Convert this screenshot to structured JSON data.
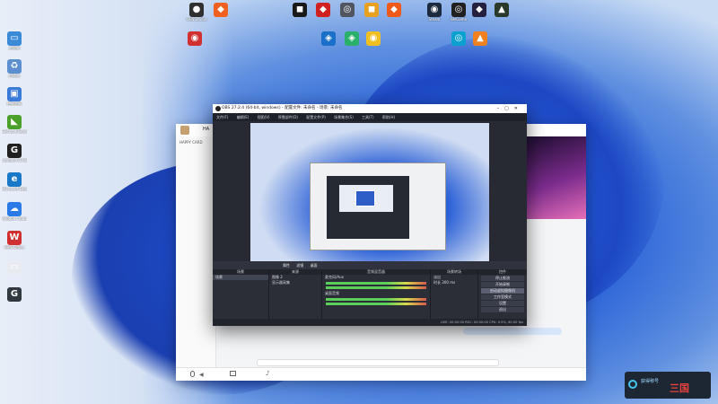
{
  "desktop_icons": [
    {
      "label": "OBS Studio",
      "glyph": "●",
      "color": "#303030"
    },
    {
      "label": "",
      "glyph": "◆",
      "color": "#f06020"
    },
    {
      "label": "",
      "glyph": "◼",
      "color": "#1a1a1a"
    },
    {
      "label": "",
      "glyph": "◆",
      "color": "#d02020"
    },
    {
      "label": "",
      "glyph": "◎",
      "color": "#505560"
    },
    {
      "label": "",
      "glyph": "◼",
      "color": "#e8a020"
    },
    {
      "label": "",
      "glyph": "◆",
      "color": "#f05a18"
    },
    {
      "label": "Steam",
      "glyph": "◉",
      "color": "#1b2a3e"
    },
    {
      "label": "WeGame",
      "glyph": "◎",
      "color": "#202020"
    },
    {
      "label": "",
      "glyph": "◆",
      "color": "#262040"
    },
    {
      "label": "",
      "glyph": "▲",
      "color": "#2a3a2a"
    },
    {
      "label": "",
      "glyph": "◉",
      "color": "#d03030"
    },
    {
      "label": "",
      "glyph": "◈",
      "color": "#1a70c8"
    },
    {
      "label": "",
      "glyph": "◈",
      "color": "#2ab06a"
    },
    {
      "label": "",
      "glyph": "◉",
      "color": "#f0c020"
    },
    {
      "label": "",
      "glyph": "◎",
      "color": "#0aa0d0"
    },
    {
      "label": "",
      "glyph": "▲",
      "color": "#f08020"
    }
  ],
  "left_icons": [
    {
      "label": "此电脑",
      "glyph": "▭",
      "color": "#3a8ad8"
    },
    {
      "label": "回收站",
      "glyph": "♻",
      "color": "#5c8fd0"
    },
    {
      "label": "控制面板",
      "glyph": "▣",
      "color": "#3a7ad8"
    },
    {
      "label": "GeForce Experience",
      "glyph": "◣",
      "color": "#4aa02a"
    },
    {
      "label": "Logitech G HUB",
      "glyph": "G",
      "color": "#202020"
    },
    {
      "label": "Microsoft Edge",
      "glyph": "e",
      "color": "#1a78c8"
    },
    {
      "label": "Alibaba Cloud",
      "glyph": "☁",
      "color": "#2a7ae8"
    },
    {
      "label": "WPS Office",
      "glyph": "W",
      "color": "#d03030"
    },
    {
      "label": "",
      "glyph": "▭",
      "color": "#e8ecf2"
    },
    {
      "label": "",
      "glyph": "G",
      "color": "#303840"
    }
  ],
  "chat": {
    "title": "HA",
    "list_items": [
      "HAPPY CARD",
      "",
      "",
      "",
      ""
    ],
    "input_placeholder": "",
    "bubble": ""
  },
  "obs": {
    "title": "OBS 27.2.4 (64-bit, windows) - 配置文件: 未命名 - 场景: 未命名",
    "menu": [
      "文件(F)",
      "编辑(E)",
      "视图(V)",
      "停靠部件(D)",
      "配置文件(P)",
      "场景集合(S)",
      "工具(T)",
      "帮助(H)"
    ],
    "source_bar": [
      "属性",
      "滤镜",
      "桌面",
      "",
      "",
      ""
    ],
    "panels": {
      "scenes_header": "场景",
      "scenes": [
        "场景"
      ],
      "sources_header": "来源",
      "sources": [
        "",
        "",
        "图像 2",
        "显示器采集"
      ],
      "mixer_header": "音频混音器",
      "mixer": [
        {
          "name": "麦克风/Aux"
        },
        {
          "name": "桌面音频"
        }
      ],
      "transitions_header": "场景转场",
      "transitions": [
        {
          "label": "淡出"
        },
        {
          "label": "时长",
          "value": "300 ms"
        }
      ],
      "controls_header": "控件",
      "controls": [
        "停止推流",
        "开始录制",
        "启动虚拟摄像机",
        "工作室模式",
        "设置",
        "退出"
      ]
    },
    "status": "LIVE: 00:00:00   REC: 00:00:00   CPU: 0.9%, 60.00 fps"
  },
  "notify": {
    "line1": "获得称号",
    "line2": "",
    "logo": "三国"
  }
}
